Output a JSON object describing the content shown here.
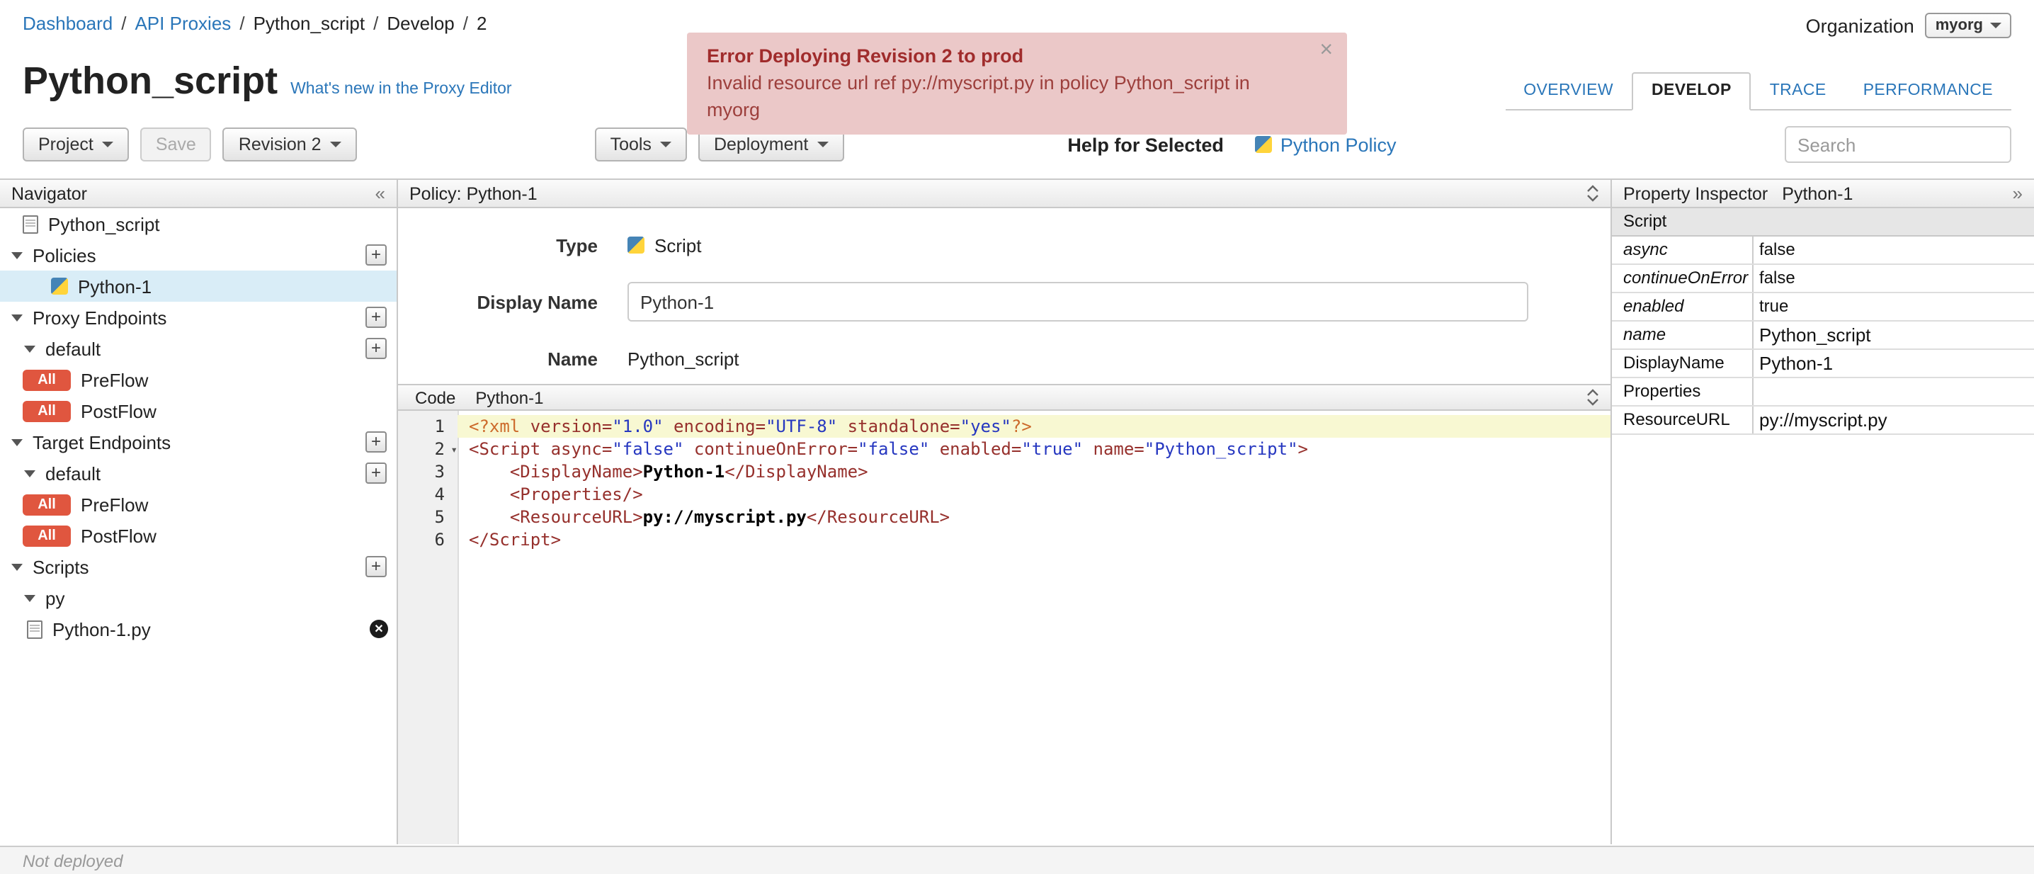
{
  "breadcrumb": {
    "separator": "/",
    "items": [
      {
        "label": "Dashboard"
      },
      {
        "label": "API Proxies"
      },
      {
        "label": "Python_script"
      },
      {
        "label": "Develop"
      },
      {
        "label": "2"
      }
    ]
  },
  "organization": {
    "label": "Organization",
    "value": "myorg"
  },
  "error_banner": {
    "title": "Error Deploying Revision 2 to prod",
    "message": "Invalid resource url ref py://myscript.py in policy Python_script in myorg",
    "close_label": "×"
  },
  "page": {
    "title": "Python_script",
    "whats_new_link": "What's new in the Proxy Editor"
  },
  "tabs": [
    {
      "label": "OVERVIEW"
    },
    {
      "label": "DEVELOP"
    },
    {
      "label": "TRACE"
    },
    {
      "label": "PERFORMANCE"
    }
  ],
  "toolbar": {
    "project": "Project",
    "save": "Save",
    "revision": "Revision 2",
    "tools": "Tools",
    "deployment": "Deployment",
    "help_for_selected": "Help for Selected",
    "policy_link": "Python Policy",
    "search_placeholder": "Search"
  },
  "navigator": {
    "title": "Navigator",
    "collapse_icon": "«",
    "root_item": "Python_script",
    "policies_section": "Policies",
    "policy_item": "Python-1",
    "proxy_endpoints_section": "Proxy Endpoints",
    "proxy_default": "default",
    "proxy_preflow": "PreFlow",
    "proxy_postflow": "PostFlow",
    "target_endpoints_section": "Target Endpoints",
    "target_default": "default",
    "target_preflow": "PreFlow",
    "target_postflow": "PostFlow",
    "scripts_section": "Scripts",
    "scripts_group": "py",
    "script_file": "Python-1.py",
    "badge_all": "All",
    "add_label": "+"
  },
  "policy_editor": {
    "header": "Policy: Python-1",
    "type_label": "Type",
    "type_value": "Script",
    "display_name_label": "Display Name",
    "display_name_value": "Python-1",
    "name_label": "Name",
    "name_value": "Python_script"
  },
  "code": {
    "header_label": "Code",
    "file_name": "Python-1",
    "lines": [
      {
        "no": "1",
        "active": true,
        "segments": [
          [
            "pi",
            "<?xml "
          ],
          [
            "attr",
            "version="
          ],
          [
            "str",
            "\"1.0\""
          ],
          [
            "attr",
            " encoding="
          ],
          [
            "str",
            "\"UTF-8\""
          ],
          [
            "attr",
            " standalone="
          ],
          [
            "str",
            "\"yes\""
          ],
          [
            "pi",
            "?>"
          ]
        ]
      },
      {
        "no": "2",
        "fold": true,
        "segments": [
          [
            "tag",
            "<Script"
          ],
          [
            "attr",
            " async="
          ],
          [
            "str",
            "\"false\""
          ],
          [
            "attr",
            " continueOnError="
          ],
          [
            "str",
            "\"false\""
          ],
          [
            "attr",
            " enabled="
          ],
          [
            "str",
            "\"true\""
          ],
          [
            "attr",
            " name="
          ],
          [
            "str",
            "\"Python_script\""
          ],
          [
            "tag",
            ">"
          ]
        ]
      },
      {
        "no": "3",
        "segments": [
          [
            "plain",
            "    "
          ],
          [
            "tag",
            "<DisplayName>"
          ],
          [
            "text",
            "Python-1"
          ],
          [
            "tag",
            "</DisplayName>"
          ]
        ]
      },
      {
        "no": "4",
        "segments": [
          [
            "plain",
            "    "
          ],
          [
            "tag",
            "<Properties/>"
          ]
        ]
      },
      {
        "no": "5",
        "segments": [
          [
            "plain",
            "    "
          ],
          [
            "tag",
            "<ResourceURL>"
          ],
          [
            "text",
            "py://myscript.py"
          ],
          [
            "tag",
            "</ResourceURL>"
          ]
        ]
      },
      {
        "no": "6",
        "segments": [
          [
            "tag",
            "</Script>"
          ]
        ]
      }
    ]
  },
  "inspector": {
    "title": "Property Inspector",
    "target": "Python-1",
    "expand_icon": "»",
    "section_header": "Script",
    "rows": [
      {
        "name": "async",
        "value": "false"
      },
      {
        "name": "continueOnError",
        "value": "false"
      },
      {
        "name": "enabled",
        "value": "true"
      },
      {
        "name": "name",
        "value": "Python_script"
      },
      {
        "name": "DisplayName",
        "value": "Python-1"
      },
      {
        "name": "Properties",
        "value": ""
      },
      {
        "name": "ResourceURL",
        "value": "py://myscript.py"
      }
    ]
  },
  "status_bar": {
    "text": "Not deployed"
  }
}
